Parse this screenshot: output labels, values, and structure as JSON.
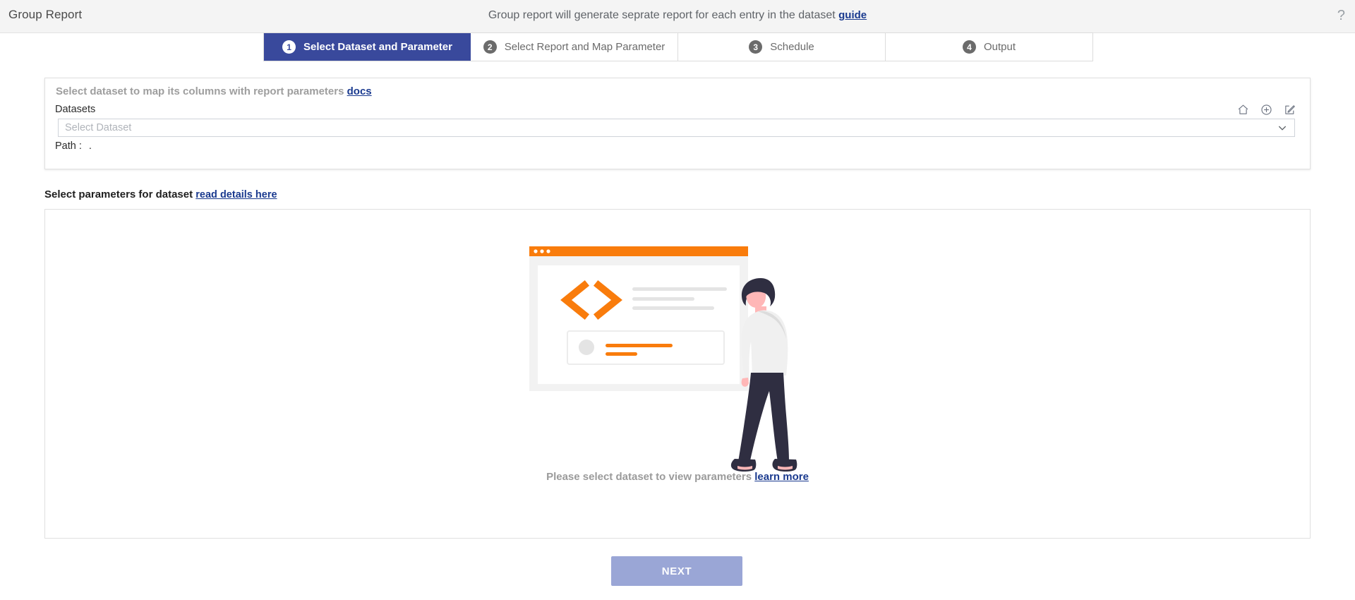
{
  "topbar": {
    "title": "Group Report",
    "notice_text": "Group report will generate seprate report for each entry in the dataset",
    "notice_link": "guide",
    "help_icon": "question-mark-icon"
  },
  "stepper": {
    "steps": [
      {
        "number": "1",
        "label": "Select Dataset and Parameter",
        "active": true
      },
      {
        "number": "2",
        "label": "Select Report and Map Parameter",
        "active": false
      },
      {
        "number": "3",
        "label": "Schedule",
        "active": false
      },
      {
        "number": "4",
        "label": "Output",
        "active": false
      }
    ]
  },
  "dataset_card": {
    "heading": "Select dataset to map its columns with report parameters",
    "heading_link": "docs",
    "datasets_label": "Datasets",
    "select_placeholder": "Select Dataset",
    "select_value": "",
    "path_label": "Path :",
    "path_value": ".",
    "icons": [
      "home-icon",
      "plus-circle-icon",
      "edit-square-icon"
    ]
  },
  "parameters": {
    "heading": "Select parameters for dataset",
    "heading_link": "read details here",
    "empty_text": "Please select dataset to view parameters",
    "empty_link": "learn more"
  },
  "footer": {
    "next_label": "NEXT"
  },
  "colors": {
    "active_step": "#39499c",
    "link": "#1a3a8f",
    "accent_orange": "#f97c0c",
    "next_button": "#9aa6d6",
    "topbar_bg": "#f4f4f4"
  }
}
